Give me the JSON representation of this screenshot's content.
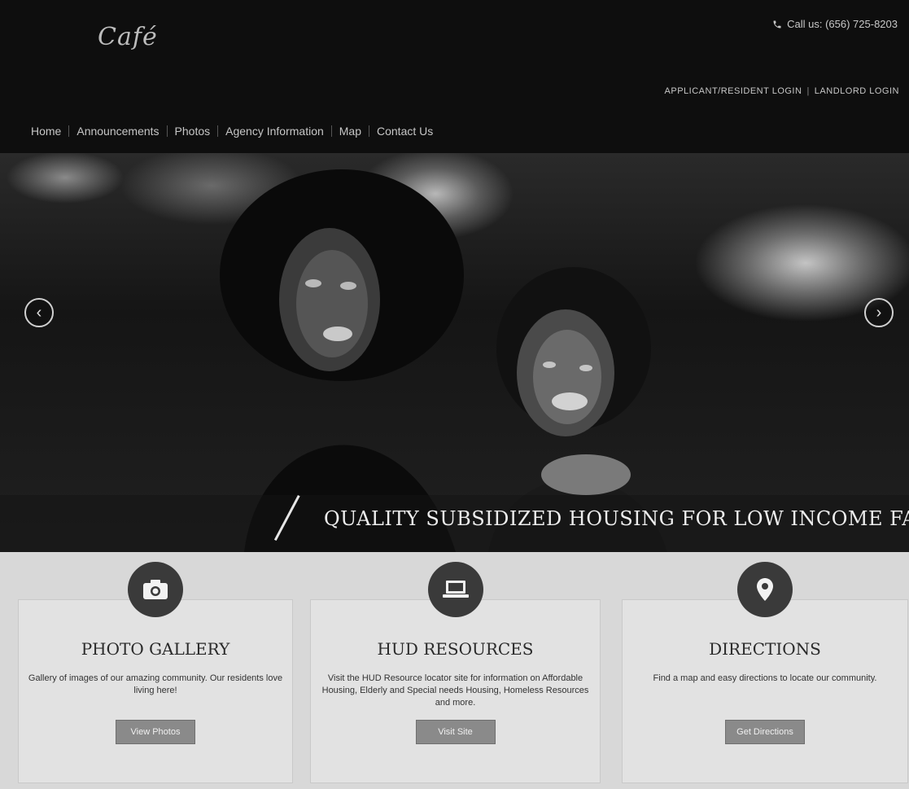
{
  "header": {
    "logo": "Café",
    "phone": "Call us: (656) 725-8203",
    "logins": {
      "applicant": "APPLICANT/RESIDENT LOGIN",
      "separator": "|",
      "landlord": "LANDLORD LOGIN"
    },
    "nav": [
      "Home",
      "Announcements",
      "Photos",
      "Agency Information",
      "Map",
      "Contact Us"
    ]
  },
  "hero": {
    "tagline": "QUALITY SUBSIDIZED HOUSING FOR LOW INCOME FAMILIES",
    "prev_icon": "chevron-left-icon",
    "next_icon": "chevron-right-icon"
  },
  "cards": [
    {
      "icon": "camera-icon",
      "title": "PHOTO GALLERY",
      "text": "Gallery of images of our amazing community. Our residents love living here!",
      "button": "View Photos"
    },
    {
      "icon": "laptop-icon",
      "title": "HUD RESOURCES",
      "text": "Visit the HUD Resource locator site for information on Affordable Housing, Elderly and Special needs Housing, Homeless Resources and more.",
      "button": "Visit Site"
    },
    {
      "icon": "map-pin-icon",
      "title": "DIRECTIONS",
      "text": "Find a map and easy directions to locate our community.",
      "button": "Get Directions"
    }
  ]
}
